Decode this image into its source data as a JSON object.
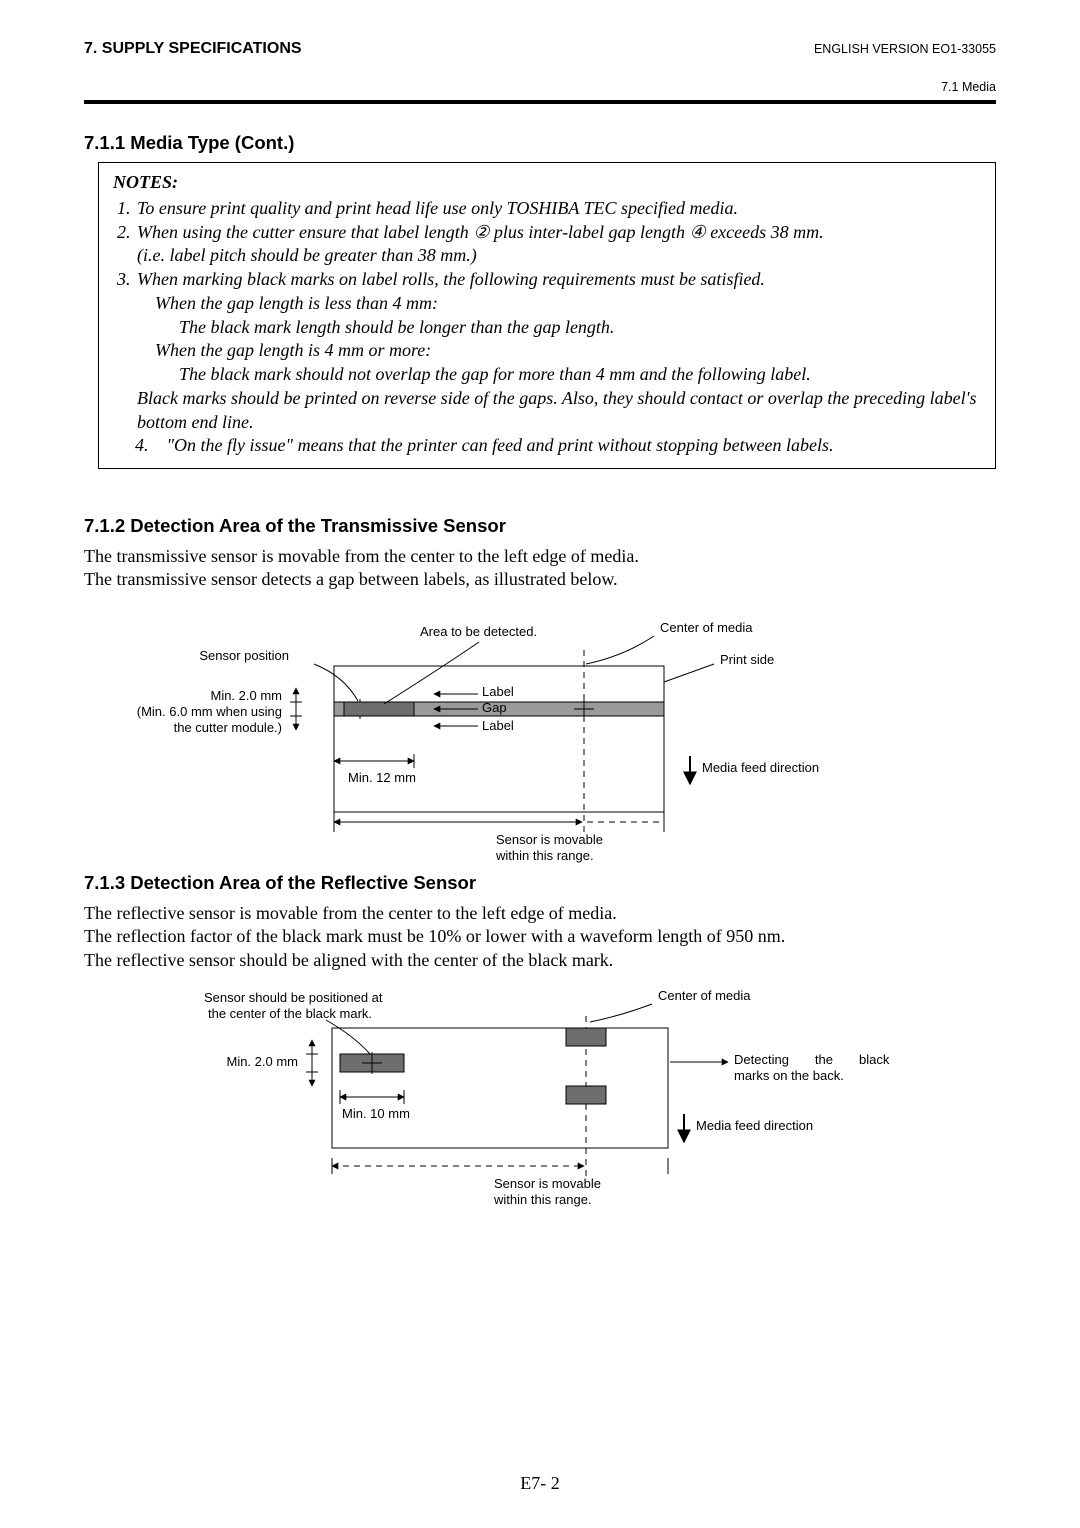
{
  "header": {
    "left": "7. SUPPLY SPECIFICATIONS",
    "right": "ENGLISH VERSION EO1-33055",
    "sub": "7.1 Media"
  },
  "section_711": {
    "title": "7.1.1  Media Type (Cont.)",
    "notes_title": "NOTES:",
    "n1": "To ensure print quality and print head life use only TOSHIBA TEC specified media.",
    "n2a": "When using the cutter ensure that label length ",
    "n2_sym1": "②",
    "n2b": " plus inter-label gap length ",
    "n2_sym2": "④",
    "n2c": " exceeds 38 mm.",
    "n2d": "(i.e. label pitch should be greater than 38 mm.)",
    "n3a": "When marking black marks on label rolls, the following requirements must be satisfied.",
    "n3b": "When the gap length is less than 4 mm:",
    "n3c": "The black mark length should be longer than the gap length.",
    "n3d": "When the gap length is 4 mm or more:",
    "n3e": "The black mark should not overlap the gap for more than 4 mm and the following label.",
    "n3f": "Black marks should be printed on reverse side of the gaps.  Also, they should contact or overlap the preceding label's bottom end line.",
    "n4": "\"On the fly issue\" means that the printer can feed and print without stopping between labels."
  },
  "section_712": {
    "title": "7.1.2  Detection Area of the Transmissive Sensor",
    "p1": "The transmissive sensor is movable from the center to the left edge of media.",
    "p2": "The transmissive sensor detects a gap between labels, as illustrated below.",
    "fig": {
      "sensor_position": "Sensor position",
      "area_detected": "Area to be detected.",
      "center_media": "Center of media",
      "print_side": "Print side",
      "min20": "Min. 2.0 mm",
      "min60a": "(Min. 6.0 mm when using",
      "min60b": "the  cutter module.)",
      "label": "Label",
      "gap": "Gap",
      "min12": "Min. 12 mm",
      "feed": "Media feed direction",
      "movable_a": "Sensor is movable",
      "movable_b": "within this range."
    }
  },
  "section_713": {
    "title": "7.1.3  Detection Area of the Reflective Sensor",
    "p1": "The reflective sensor is movable from the center to the left edge of media.",
    "p2": "The reflection factor of the black mark must be 10% or lower with a waveform length of 950 nm.",
    "p3": "The reflective sensor should be aligned with the center of the black mark.",
    "fig": {
      "sensor_pos_a": "Sensor should be positioned at",
      "sensor_pos_b": "the center of the black mark.",
      "center_media": "Center of media",
      "min20": "Min. 2.0 mm",
      "detect_a": "Detecting",
      "detect_b": "the",
      "detect_c": "black",
      "detect_d": "marks on the back.",
      "min10": "Min. 10 mm",
      "feed": "Media feed direction",
      "movable_a": "Sensor is movable",
      "movable_b": "within this range."
    }
  },
  "page_number": "E7- 2"
}
